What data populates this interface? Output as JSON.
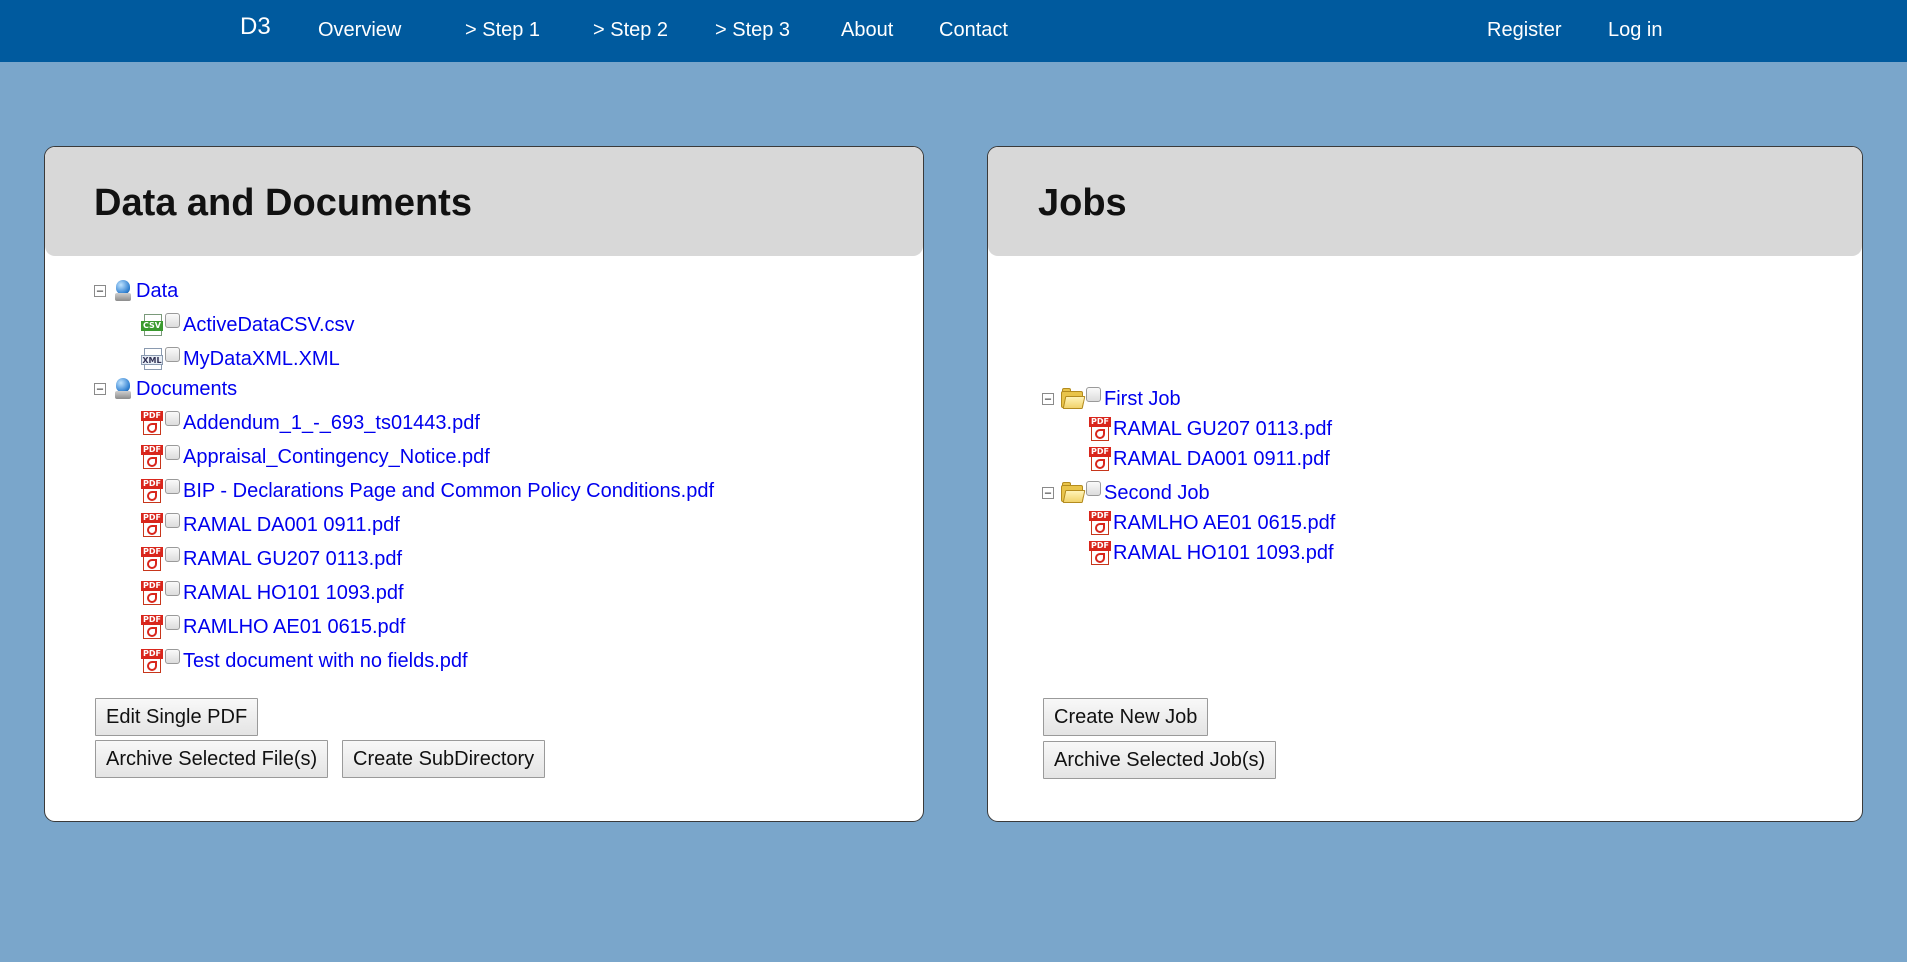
{
  "nav": {
    "brand": "D3",
    "items": [
      "Overview",
      "> Step 1",
      "> Step 2",
      "> Step 3",
      "About",
      "Contact"
    ],
    "register": "Register",
    "login": "Log in"
  },
  "left_panel": {
    "title": "Data and Documents",
    "data_folder": {
      "label": "Data",
      "files": [
        {
          "name": "ActiveDataCSV.csv",
          "icon": "csv-file-icon"
        },
        {
          "name": "MyDataXML.XML",
          "icon": "xml-file-icon"
        }
      ]
    },
    "documents_folder": {
      "label": "Documents",
      "files": [
        "Addendum_1_-_693_ts01443.pdf",
        "Appraisal_Contingency_Notice.pdf",
        "BIP - Declarations Page and Common Policy Conditions.pdf",
        "RAMAL DA001 0911.pdf",
        "RAMAL GU207 0113.pdf",
        "RAMAL HO101 1093.pdf",
        "RAMLHO AE01 0615.pdf",
        "Test document with no fields.pdf"
      ]
    },
    "buttons": {
      "edit_single_pdf": "Edit Single PDF",
      "archive_selected": "Archive Selected File(s)",
      "create_subdirectory": "Create SubDirectory"
    }
  },
  "right_panel": {
    "title": "Jobs",
    "jobs": [
      {
        "label": "First Job",
        "files": [
          "RAMAL GU207 0113.pdf",
          "RAMAL DA001 0911.pdf"
        ]
      },
      {
        "label": "Second Job",
        "files": [
          "RAMLHO AE01 0615.pdf",
          "RAMAL HO101 1093.pdf"
        ]
      }
    ],
    "buttons": {
      "create_new_job": "Create New Job",
      "archive_selected_jobs": "Archive Selected Job(s)"
    }
  },
  "icon_labels": {
    "pdf": "PDF",
    "csv": "CSV",
    "xml": "XML",
    "collapse": "−"
  },
  "colors": {
    "navbar": "#005a9e",
    "background": "#7aa6cb",
    "link": "#0000ee",
    "panel_header": "#d8d8d8"
  }
}
